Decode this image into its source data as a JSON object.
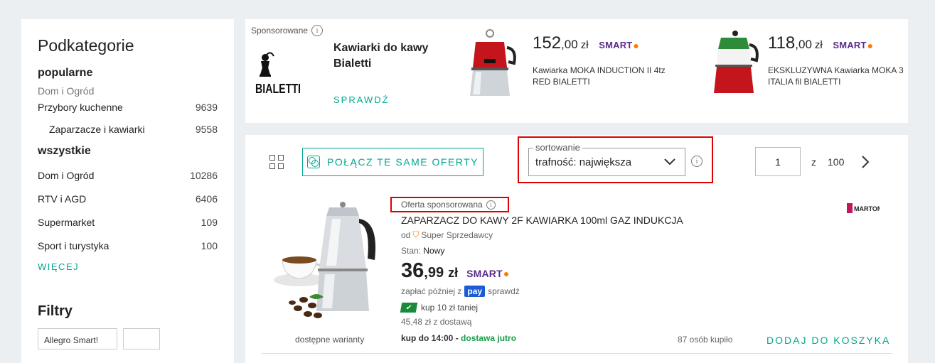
{
  "sidebar": {
    "title": "Podkategorie",
    "popular_heading": "popularne",
    "popular_crumb": "Dom i Ogród",
    "popular_items": [
      {
        "label": "Przybory kuchenne",
        "count": "9639"
      },
      {
        "label": "Zaparzacze i kawiarki",
        "count": "9558"
      }
    ],
    "all_heading": "wszystkie",
    "all_items": [
      {
        "label": "Dom i Ogród",
        "count": "10286"
      },
      {
        "label": "RTV i AGD",
        "count": "6406"
      },
      {
        "label": "Supermarket",
        "count": "109"
      },
      {
        "label": "Sport i turystyka",
        "count": "100"
      }
    ],
    "more_label": "WIĘCEJ",
    "filters_heading": "Filtry",
    "filter_partial_text": "Allegro Smart!"
  },
  "banner": {
    "sponsored_label": "Sponsorowane",
    "brand_logo_text": "BIALETTI",
    "title": "Kawiarki do kawy Bialetti",
    "cta": "SPRAWDŹ",
    "products": [
      {
        "price_int": "152",
        "price_dec": ",00",
        "currency": "zł",
        "smart": "SMART",
        "name": "Kawiarka MOKA INDUCTION II 4tz RED BIALETTI",
        "color": "#c4151c"
      },
      {
        "price_int": "118",
        "price_dec": ",00",
        "currency": "zł",
        "smart": "SMART",
        "name": "EKSKLUZYWNA Kawiarka MOKA 3 ITALIA fil BIALETTI",
        "color": "#2e8b3a"
      }
    ]
  },
  "toolbar": {
    "join_offers_label": "POŁĄCZ TE SAME OFERTY",
    "sort_legend": "sortowanie",
    "sort_value": "trafność: największa",
    "page_current": "1",
    "page_of": "z",
    "page_total": "100"
  },
  "offer": {
    "sponsored_label": "Oferta sponsorowana",
    "title": "ZAPARZACZ DO KAWY 2F KAWIARKA 100ml GAZ INDUKCJA",
    "seller_prefix": "od",
    "seller_label": "Super Sprzedawcy",
    "condition_label": "Stan:",
    "condition_value": "Nowy",
    "price_int": "36",
    "price_dec": ",99",
    "currency": "zł",
    "smart": "SMART",
    "paylater_prefix": "zapłać później z",
    "pay_badge": "pay",
    "paylater_suffix": "sprawdź",
    "coupon": "kup 10 zł taniej",
    "shipping_cost": "45,48 zł z dostawą",
    "delivery_prefix": "kup do 14:00 -",
    "delivery_highlight": "dostawa jutro",
    "buyers": "87 osób kupiło",
    "add_to_cart": "DODAJ DO KOSZYKA",
    "variants": "dostępne warianty",
    "seller_logo_text": "MARTOM"
  },
  "colors": {
    "accent": "#00a790",
    "highlight_box": "#e00000",
    "smart_purple": "#5a2b8a",
    "smart_orange": "#ff7a00",
    "delivery_green": "#1a9c4a"
  }
}
